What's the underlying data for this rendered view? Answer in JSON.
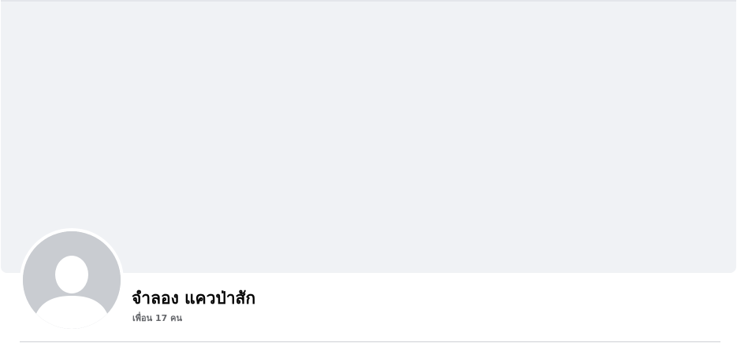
{
  "profile": {
    "name": "จำลอง แควป่าสัก",
    "friends_count": "เพื่อน 17 คน"
  },
  "colors": {
    "cover": "#f0f2f5",
    "avatar_bg": "#c9ccd1",
    "name_text": "#050505",
    "secondary_text": "#65676b"
  },
  "icons": {
    "avatar": "default-person-silhouette-icon"
  }
}
